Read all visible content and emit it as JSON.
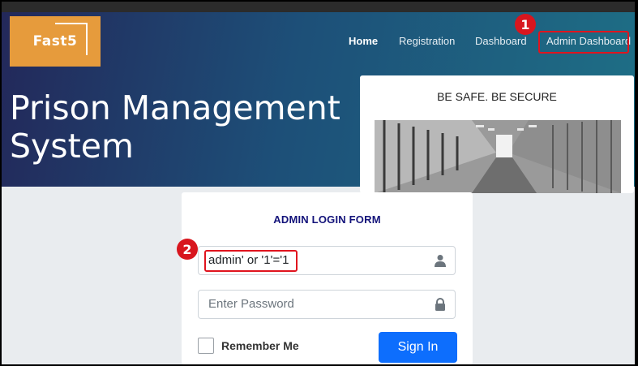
{
  "brand": {
    "logo_text": "Fast5"
  },
  "nav": {
    "items": [
      {
        "label": "Home"
      },
      {
        "label": "Registration"
      },
      {
        "label": "Dashboard"
      },
      {
        "label": "Admin Dashboard"
      }
    ]
  },
  "hero": {
    "title_line1": "Prison Management",
    "title_line2": "System"
  },
  "promo_card": {
    "title": "BE SAFE. BE SECURE"
  },
  "login_form": {
    "title": "ADMIN LOGIN FORM",
    "username_value": "admin' or '1'='1",
    "password_placeholder": "Enter Password",
    "remember_label": "Remember Me",
    "signin_label": "Sign In"
  },
  "annotations": {
    "step1": "1",
    "step2": "2",
    "highlight_color": "#e0141e"
  },
  "icons": {
    "username": "user-icon",
    "password": "lock-icon"
  },
  "colors": {
    "brand_orange": "#e69b3c",
    "form_title": "#13137a",
    "primary_button": "#0d6efd"
  }
}
